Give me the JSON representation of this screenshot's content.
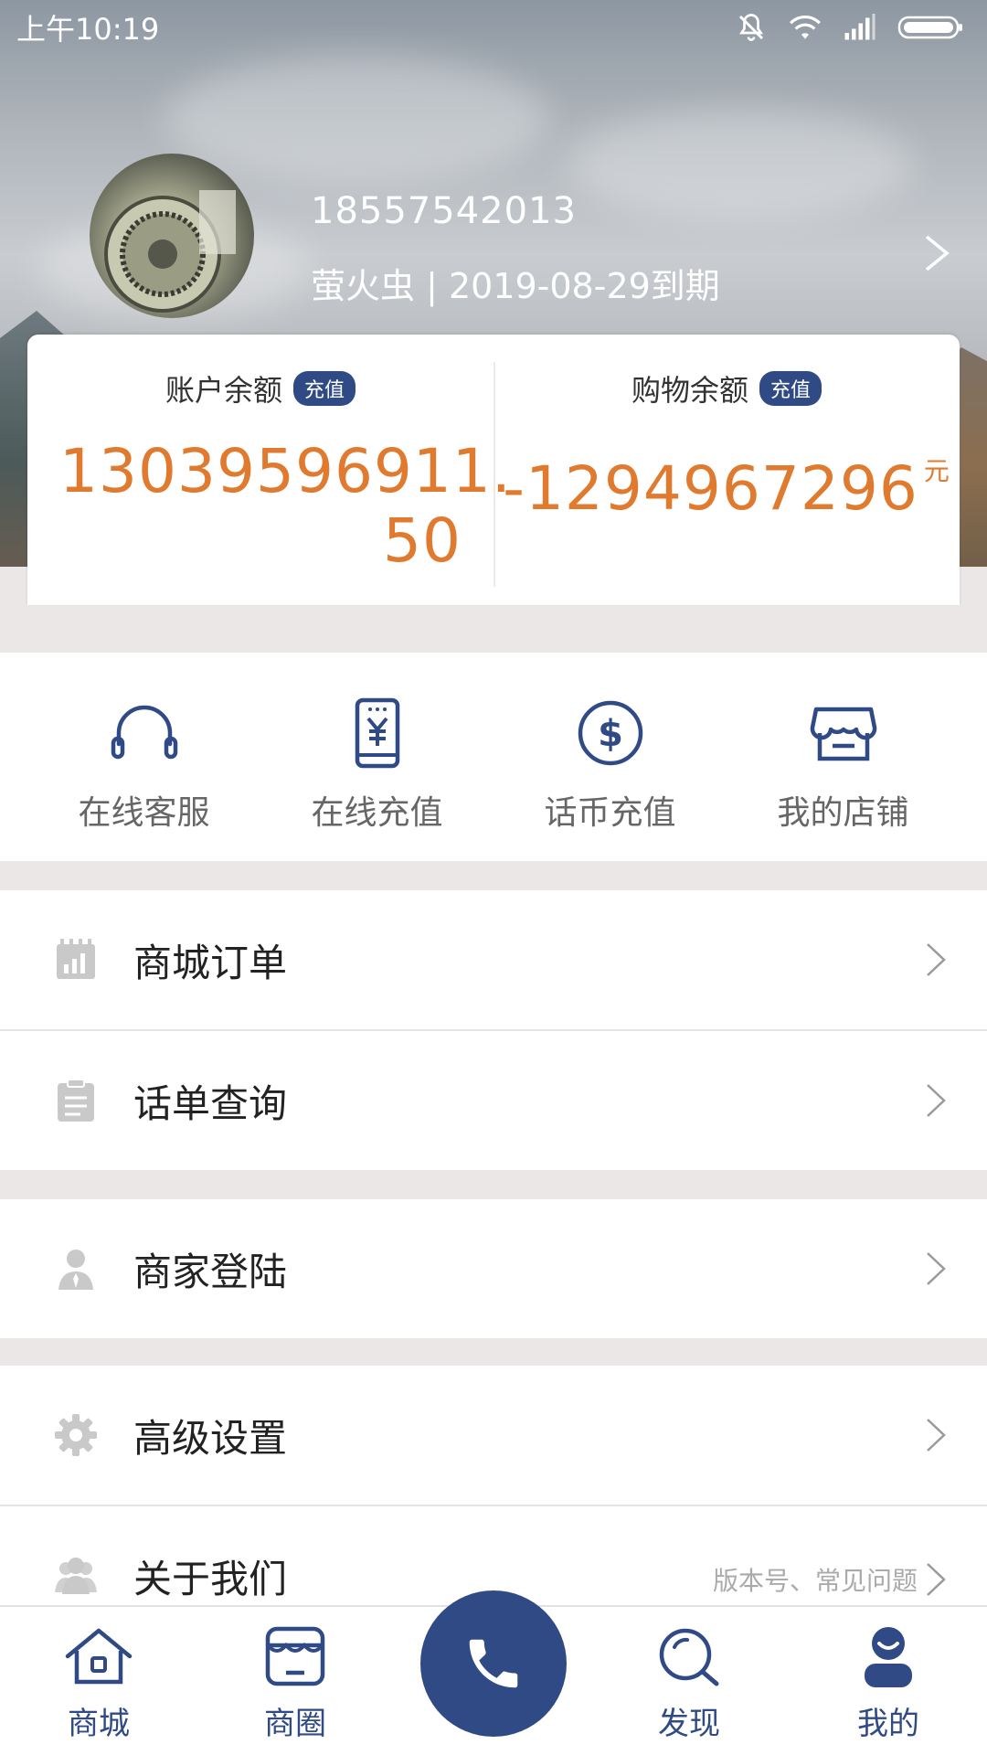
{
  "status_bar": {
    "time": "上午10:19",
    "icons": [
      "mute-icon",
      "wifi-icon",
      "signal-icon",
      "battery-icon"
    ]
  },
  "profile": {
    "phone": "18557542013",
    "member_line": "萤火虫 | 2019-08-29到期"
  },
  "balances": {
    "account": {
      "label": "账户余额",
      "badge": "充值",
      "amount_line1": "13039596911.",
      "amount_line2": "50"
    },
    "shopping": {
      "label": "购物余额",
      "badge": "充值",
      "amount": "-1294967296",
      "unit": "元"
    }
  },
  "quick_actions": [
    {
      "label": "在线客服",
      "icon": "headset-icon"
    },
    {
      "label": "在线充值",
      "icon": "phone-yuan-icon"
    },
    {
      "label": "话币充值",
      "icon": "dollar-coin-icon"
    },
    {
      "label": "我的店铺",
      "icon": "store-icon"
    }
  ],
  "menu": [
    {
      "label": "商城订单",
      "icon": "orders-icon"
    },
    {
      "label": "话单查询",
      "icon": "clipboard-icon"
    },
    {
      "label": "商家登陆",
      "icon": "merchant-icon"
    },
    {
      "label": "高级设置",
      "icon": "gear-icon"
    },
    {
      "label": "关于我们",
      "icon": "group-icon",
      "hint": "版本号、常见问题"
    }
  ],
  "bottom_nav": [
    {
      "label": "商城",
      "icon": "home-icon"
    },
    {
      "label": "商圈",
      "icon": "shop-circle-icon"
    },
    {
      "label": "",
      "icon": "phone-call-icon"
    },
    {
      "label": "发现",
      "icon": "discover-icon"
    },
    {
      "label": "我的",
      "icon": "profile-icon"
    }
  ],
  "colors": {
    "brand": "#2f4a84",
    "amount": "#e07a2f",
    "page_bg": "#ebe7e7"
  }
}
